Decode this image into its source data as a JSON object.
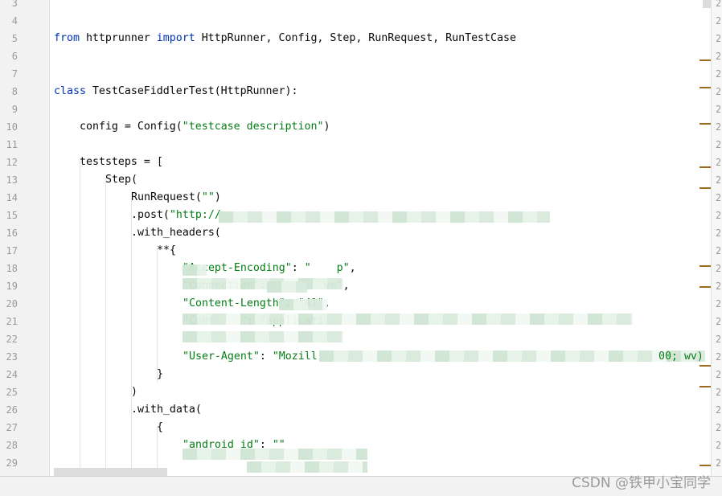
{
  "editor": {
    "lines": [
      {
        "n": "3",
        "indent": 0,
        "tokens": []
      },
      {
        "n": "4",
        "indent": 0,
        "tokens": []
      },
      {
        "n": "5",
        "indent": 0,
        "tokens": [
          [
            "from",
            "kw"
          ],
          [
            " httprunner ",
            ""
          ],
          [
            "import",
            "kw"
          ],
          [
            " HttpRunner, Config, Step, RunRequest, RunTestCase",
            ""
          ]
        ]
      },
      {
        "n": "6",
        "indent": 0,
        "tokens": []
      },
      {
        "n": "7",
        "indent": 0,
        "tokens": []
      },
      {
        "n": "8",
        "indent": 0,
        "tokens": [
          [
            "class",
            "kw"
          ],
          [
            " TestCaseFiddlerTest(HttpRunner):",
            ""
          ]
        ]
      },
      {
        "n": "9",
        "indent": 0,
        "tokens": []
      },
      {
        "n": "10",
        "indent": 4,
        "tokens": [
          [
            "config = Config(",
            ""
          ],
          [
            "\"testcase description\"",
            "str"
          ],
          [
            ")",
            ""
          ]
        ]
      },
      {
        "n": "11",
        "indent": 0,
        "tokens": []
      },
      {
        "n": "12",
        "indent": 4,
        "tokens": [
          [
            "teststeps = [",
            ""
          ]
        ]
      },
      {
        "n": "13",
        "indent": 8,
        "tokens": [
          [
            "Step(",
            ""
          ]
        ]
      },
      {
        "n": "14",
        "indent": 12,
        "tokens": [
          [
            "RunRequest(",
            ""
          ],
          [
            "\"\"",
            "str"
          ],
          [
            ")",
            ""
          ]
        ]
      },
      {
        "n": "15",
        "indent": 12,
        "tokens": [
          [
            ".post(",
            ""
          ],
          [
            "\"http://",
            "str"
          ]
        ]
      },
      {
        "n": "16",
        "indent": 12,
        "tokens": [
          [
            ".with_headers(",
            ""
          ]
        ]
      },
      {
        "n": "17",
        "indent": 16,
        "tokens": [
          [
            "**{",
            ""
          ]
        ]
      },
      {
        "n": "18",
        "indent": 20,
        "tokens": [
          [
            "\"Accept-Encoding\"",
            "str"
          ],
          [
            ": ",
            ""
          ],
          [
            "\"    p\"",
            "str"
          ],
          [
            ",",
            ""
          ]
        ]
      },
      {
        "n": "19",
        "indent": 20,
        "tokens": [
          [
            "\"Connection\"",
            "str"
          ],
          [
            ": ",
            ""
          ],
          [
            "\"    -  ve\"",
            "str"
          ],
          [
            ",",
            ""
          ]
        ]
      },
      {
        "n": "20",
        "indent": 20,
        "tokens": [
          [
            "\"Content-Length\"",
            "str"
          ],
          [
            ": ",
            ""
          ],
          [
            "\"41\"",
            "str"
          ],
          [
            ",",
            ""
          ]
        ]
      },
      {
        "n": "21",
        "indent": 20,
        "tokens": [
          [
            "\"Cont    \"",
            "str"
          ],
          [
            ": ",
            ""
          ],
          [
            "\"applicati",
            "str"
          ]
        ]
      },
      {
        "n": "22",
        "indent": 20,
        "tokens": []
      },
      {
        "n": "23",
        "indent": 20,
        "tokens": [
          [
            "\"User-Agent\"",
            "str"
          ],
          [
            ": ",
            ""
          ],
          [
            "\"Mozill",
            "str"
          ]
        ]
      },
      {
        "n": "24",
        "indent": 16,
        "tokens": [
          [
            "}",
            ""
          ]
        ]
      },
      {
        "n": "25",
        "indent": 12,
        "tokens": [
          [
            ")",
            ""
          ]
        ]
      },
      {
        "n": "26",
        "indent": 12,
        "tokens": [
          [
            ".with_data(",
            ""
          ]
        ]
      },
      {
        "n": "27",
        "indent": 16,
        "tokens": [
          [
            "{",
            ""
          ]
        ]
      },
      {
        "n": "28",
        "indent": 20,
        "tokens": [
          [
            "\"android_id\"",
            "str"
          ],
          [
            ": ",
            ""
          ],
          [
            "\"\"",
            "str"
          ]
        ]
      },
      {
        "n": "29",
        "indent": 20,
        "tokens": []
      }
    ],
    "line23_tail": "00; wv)",
    "right_gutter_digit": "2"
  },
  "watermark": "CSDN @铁甲小宝同学",
  "colors": {
    "keyword": "#0033b3",
    "string": "#067d17",
    "marker": "#9c6a1c"
  }
}
